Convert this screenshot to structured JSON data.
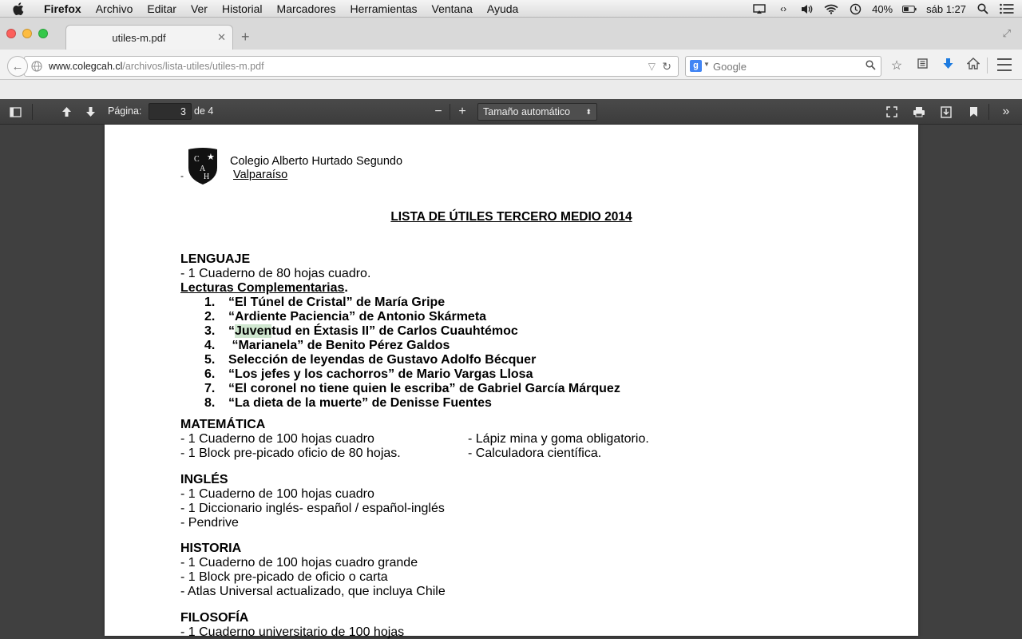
{
  "menubar": {
    "app": "Firefox",
    "items": [
      "Archivo",
      "Editar",
      "Ver",
      "Historial",
      "Marcadores",
      "Herramientas",
      "Ventana",
      "Ayuda"
    ],
    "battery": "40%",
    "clock": "sáb 1:27",
    "icons": [
      "apple-logo-icon",
      "airplay-icon",
      "code-icon",
      "volume-icon",
      "wifi-icon",
      "time-machine-icon",
      "battery-icon",
      "spotlight-icon",
      "notification-list-icon"
    ]
  },
  "tab": {
    "title": "utiles-m.pdf"
  },
  "urlbar": {
    "domain": "www.colegcah.cl",
    "path": "/archivos/lista-utiles/utiles-m.pdf"
  },
  "search": {
    "placeholder": "Google"
  },
  "pdf_toolbar": {
    "page_label": "Página:",
    "page_current": "3",
    "page_total": "de 4",
    "zoom": "Tamaño automático"
  },
  "document": {
    "school_name": "Colegio Alberto Hurtado Segundo",
    "school_city": "Valparaíso",
    "crest_letters": [
      "C",
      "A",
      "H"
    ],
    "dash": "-",
    "title": "LISTA DE ÚTILES TERCERO MEDIO 2014",
    "lenguaje": {
      "heading": "LENGUAJE",
      "items": [
        "- 1 Cuaderno de 80 hojas cuadro."
      ],
      "sub_heading": "Lecturas Complementarias",
      "sub_heading_dot": ".",
      "readings": [
        {
          "num": "1.",
          "text": "“El Túnel de Cristal”  de María Gripe"
        },
        {
          "num": "2.",
          "text": "“Ardiente Paciencia” de Antonio Skármeta"
        },
        {
          "num": "3.",
          "pre": "“",
          "hl": "Juven",
          "text": "tud en Éxtasis II” de Carlos Cuauhtémoc"
        },
        {
          "num": "4.",
          "text": " “Marianela” de Benito Pérez Galdos"
        },
        {
          "num": "5.",
          "text": "Selección de leyendas de Gustavo Adolfo Bécquer"
        },
        {
          "num": "6.",
          "text": "“Los jefes y los cachorros” de Mario Vargas Llosa"
        },
        {
          "num": "7.",
          "text": "“El coronel no tiene quien le escriba” de Gabriel García Márquez"
        },
        {
          "num": "8.",
          "text": "“La dieta de la muerte” de Denisse Fuentes"
        }
      ]
    },
    "matematica": {
      "heading": "MATEMÁTICA",
      "rows": [
        [
          "- 1 Cuaderno de 100 hojas cuadro",
          "- Lápiz mina y goma obligatorio."
        ],
        [
          "- 1 Block pre-picado oficio de 80 hojas.",
          "- Calculadora científica."
        ]
      ]
    },
    "ingles": {
      "heading": "INGLÉS",
      "items": [
        "- 1 Cuaderno de 100 hojas cuadro",
        "- 1 Diccionario inglés- español / español-inglés",
        "- Pendrive"
      ]
    },
    "historia": {
      "heading": "HISTORIA",
      "items": [
        "- 1 Cuaderno de 100 hojas cuadro grande",
        "- 1 Block pre-picado de oficio o carta",
        "- Atlas Universal actualizado, que incluya Chile"
      ]
    },
    "filosofia": {
      "heading": "FILOSOFÍA",
      "items": [
        "- 1 Cuaderno universitario de 100 hojas"
      ]
    }
  }
}
